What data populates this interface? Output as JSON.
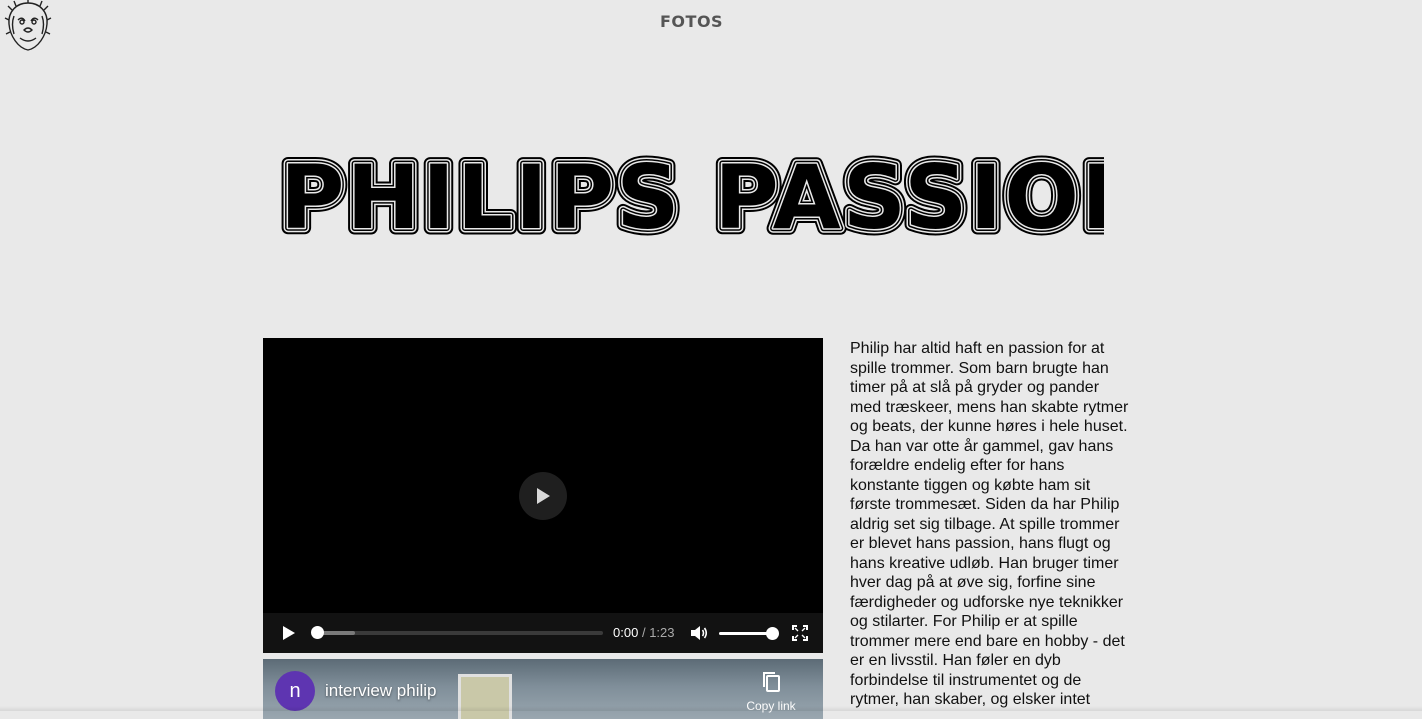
{
  "header": {
    "logo_icon": "lion-head-icon",
    "nav_fotos": "FOTOS"
  },
  "hero": {
    "title": "PHILIPS PASSION"
  },
  "video": {
    "current_time": "0:00",
    "separator": "/",
    "duration": "1:23",
    "progress_fraction": 0.0,
    "volume_fraction": 1.0,
    "icons": [
      "play-icon",
      "volume-icon",
      "fullscreen-icon"
    ]
  },
  "embed": {
    "avatar_letter": "n",
    "title": "interview philip",
    "copy_label": "Copy link",
    "avatar_color": "#5e35b1"
  },
  "article": {
    "text": "Philip har altid haft en passion for at spille trommer. Som barn brugte han timer på at slå på gryder og pander med træskeer, mens han skabte rytmer og beats, der kunne høres i hele huset. Da han var otte år gammel, gav hans forældre endelig efter for hans konstante tiggen og købte ham sit første trommesæt. Siden da har Philip aldrig set sig tilbage. At spille trommer er blevet hans passion, hans flugt og hans kreative udløb. Han bruger timer hver dag på at øve sig, forfine sine færdigheder og udforske nye teknikker og stilarter. For Philip er at spille trommer mere end bare en hobby - det er en livsstil. Han føler en dyb forbindelse til instrumentet og de rytmer, han skaber, og elsker intet"
  }
}
